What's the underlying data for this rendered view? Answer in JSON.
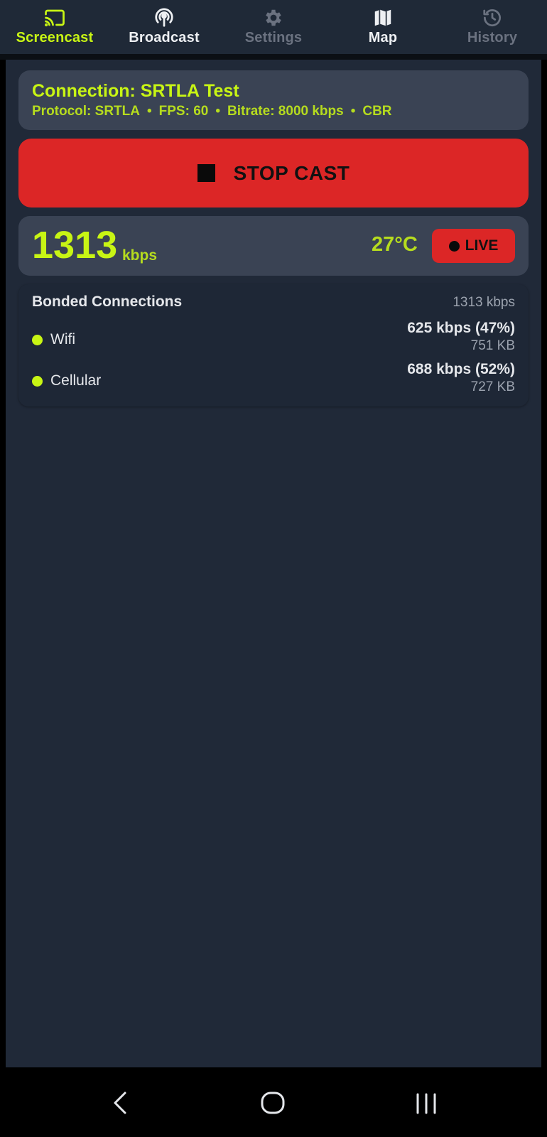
{
  "tabs": [
    {
      "label": "Screencast",
      "icon": "cast-icon",
      "state": "active"
    },
    {
      "label": "Broadcast",
      "icon": "broadcast-icon",
      "state": "bright"
    },
    {
      "label": "Settings",
      "icon": "gear-icon",
      "state": "dim"
    },
    {
      "label": "Map",
      "icon": "map-icon",
      "state": "bright"
    },
    {
      "label": "History",
      "icon": "history-icon",
      "state": "dim"
    }
  ],
  "connection": {
    "title": "Connection: SRTLA Test",
    "protocol": "Protocol: SRTLA",
    "fps": "FPS: 60",
    "bitrate": "Bitrate: 8000 kbps",
    "mode": "CBR",
    "separator": "•"
  },
  "stop_button": {
    "label": "STOP CAST",
    "icon": "stop-icon"
  },
  "stats": {
    "bitrate_value": "1313",
    "bitrate_unit": "kbps",
    "temperature": "27°C",
    "live_label": "LIVE"
  },
  "bonded": {
    "title": "Bonded Connections",
    "total": "1313 kbps",
    "connections": [
      {
        "name": "Wifi",
        "rate": "625 kbps (47%)",
        "bytes": "751 KB"
      },
      {
        "name": "Cellular",
        "rate": "688 kbps (52%)",
        "bytes": "727 KB"
      }
    ]
  },
  "colors": {
    "accent": "#c8f514",
    "danger": "#dc2626",
    "background": "#202938",
    "card": "#3a4354"
  },
  "system_nav": {
    "back_icon": "back-icon",
    "home_icon": "home-icon",
    "recents_icon": "recents-icon"
  }
}
